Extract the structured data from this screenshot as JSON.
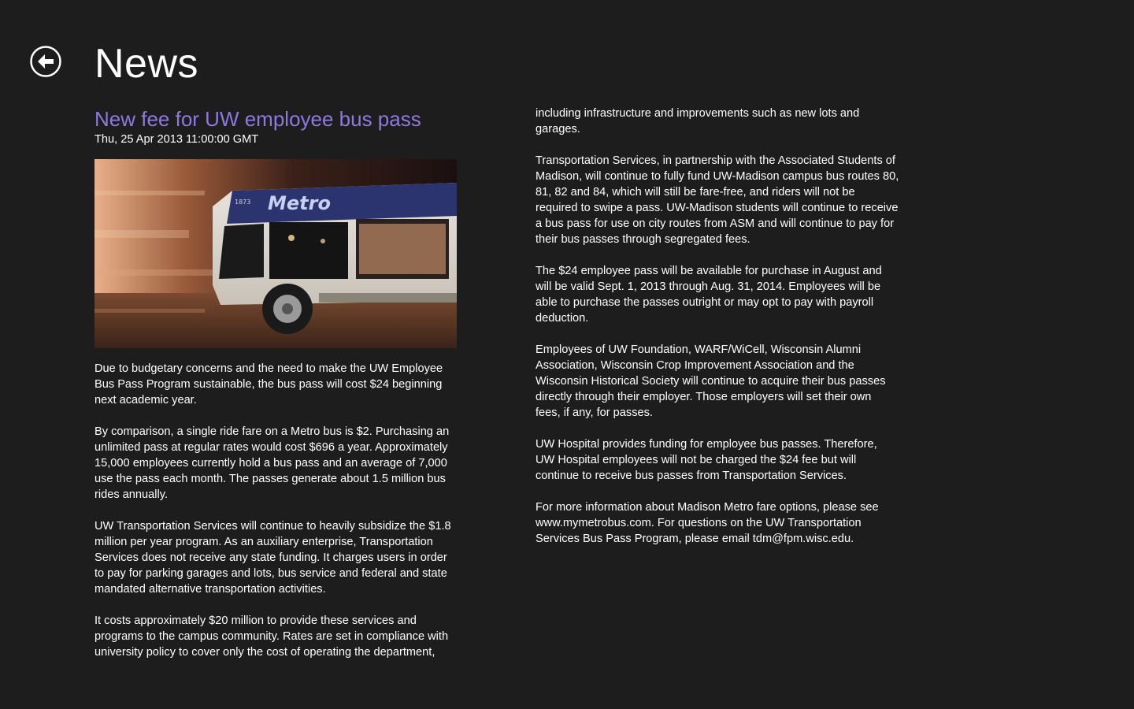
{
  "header": {
    "title": "News",
    "back_icon": "back-arrow-circle-icon"
  },
  "article": {
    "title": "New fee for UW employee bus pass",
    "date": "Thu, 25 Apr 2013 11:00:00 GMT",
    "image": {
      "bus_number": "1873",
      "bus_brand": "Metro"
    },
    "left_paragraphs": [
      "Due to budgetary concerns and the need to make the UW Employee Bus Pass Program sustainable, the bus pass will cost $24 beginning next academic year.",
      "By comparison, a single ride fare on a Metro bus is $2. Purchasing an unlimited pass at regular rates would cost $696 a year. Approximately 15,000 employees currently hold a bus pass and an average of 7,000 use the pass each month. The passes generate about 1.5 million bus rides annually.",
      "UW Transportation Services will continue to heavily subsidize the $1.8 million per year program.  As an auxiliary enterprise, Transportation Services does not receive any state funding. It charges users in order to pay for parking garages and lots, bus service and federal and state mandated alternative transportation activities.",
      "It costs approximately $20 million to provide these services and programs to the campus community. Rates are set in compliance with university policy to cover only the cost of operating the department,"
    ],
    "right_paragraphs": [
      "including infrastructure and improvements such as new lots and garages.",
      "Transportation Services, in partnership with the Associated Students of Madison, will continue to fully fund UW-Madison campus bus routes 80, 81, 82 and 84, which will still be fare-free, and riders will not be required to swipe a pass. UW-Madison students will continue to receive a bus pass for use on city routes from ASM and will continue to pay for their bus passes through segregated fees.",
      "The $24 employee pass will be available for purchase in August and will be valid Sept. 1, 2013 through Aug. 31, 2014. Employees will be able to purchase the passes outright or may opt to pay with payroll deduction.",
      "Employees of UW Foundation, WARF/WiCell, Wisconsin Alumni Association, Wisconsin Crop Improvement Association and the Wisconsin Historical Society will continue to acquire their bus passes directly through their employer. Those employers will set their own fees, if any, for passes.",
      "UW Hospital provides funding for employee bus passes. Therefore, UW Hospital employees will not be charged the $24 fee but will continue to receive bus passes from Transportation Services.",
      "For more information about Madison Metro fare options, please see www.mymetrobus.com.  For questions on the UW Transportation Services Bus Pass Program, please email tdm@fpm.wisc.edu."
    ]
  },
  "colors": {
    "background": "#1d1d1d",
    "title_accent": "#8f78e0",
    "text": "#ffffff"
  }
}
